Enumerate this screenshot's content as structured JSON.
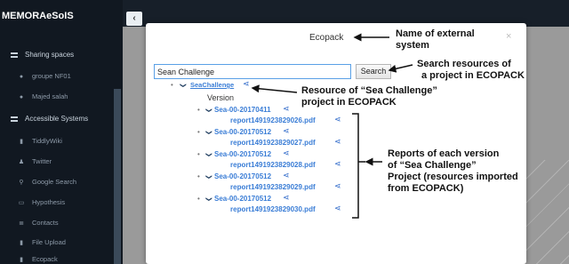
{
  "sidebar": {
    "brand": "MEMORAeSoIS",
    "sections": [
      {
        "label": "Sharing spaces",
        "items": [
          "groupe NF01",
          "Majed salah"
        ]
      },
      {
        "label": "Accessible Systems",
        "items": [
          "TiddlyWiki",
          "Twitter",
          "Google Search",
          "Hypothesis",
          "Contacts",
          "File Upload",
          "Ecopack"
        ]
      }
    ]
  },
  "topbar": {
    "toggle_icon": "chevron-left"
  },
  "modal": {
    "title": "Ecopack",
    "close": "×",
    "search": {
      "value": "Sean Challenge",
      "button": "Search"
    },
    "root": "SeaChallenge",
    "version_label": "Version",
    "versions": [
      {
        "name": "Sea-00-20170411",
        "report": "report1491923829026.pdf"
      },
      {
        "name": "Sea-00-20170512",
        "report": "report1491923829027.pdf"
      },
      {
        "name": "Sea-00-20170512",
        "report": "report1491923829028.pdf"
      },
      {
        "name": "Sea-00-20170512",
        "report": "report1491923829029.pdf"
      },
      {
        "name": "Sea-00-20170512",
        "report": "report1491923829030.pdf"
      }
    ]
  },
  "annotations": {
    "external_system": [
      "Name of external",
      "system"
    ],
    "search_resources": [
      "Search resources  of",
      "a project in ECOPACK"
    ],
    "resource": [
      "Resource of “Sea Challenge”",
      "project in ECOPACK"
    ],
    "reports": [
      "Reports of each version",
      "of “Sea Challenge”",
      " Project (resources imported",
      "from ECOPACK)"
    ]
  },
  "colors": {
    "sidebar": "#1f2d3d",
    "link": "#3a7dd6",
    "share_icon": "#2a66c8",
    "overlay": "#9a9a9a"
  }
}
